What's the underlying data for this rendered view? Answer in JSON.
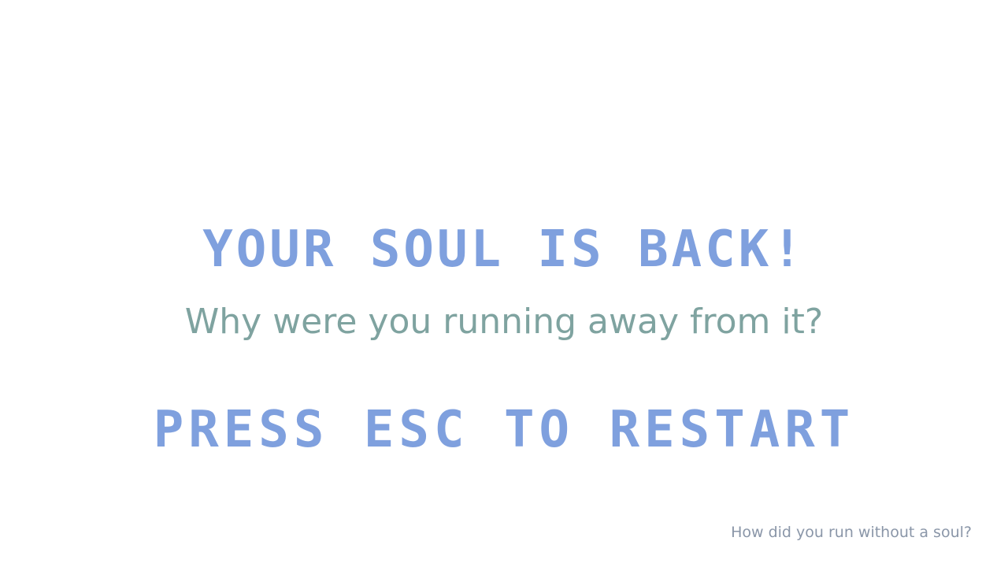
{
  "screen": {
    "title": "YOUR SOUL IS BACK!",
    "subtitle": "Why were you running away from it?",
    "restart_prompt": "PRESS ESC TO RESTART",
    "footer_note": "How did you run without a soul?"
  },
  "colors": {
    "background": "#ffffff",
    "title": "#7fa0de",
    "subtitle": "#7fa3a0",
    "footer": "#8a96a8"
  }
}
